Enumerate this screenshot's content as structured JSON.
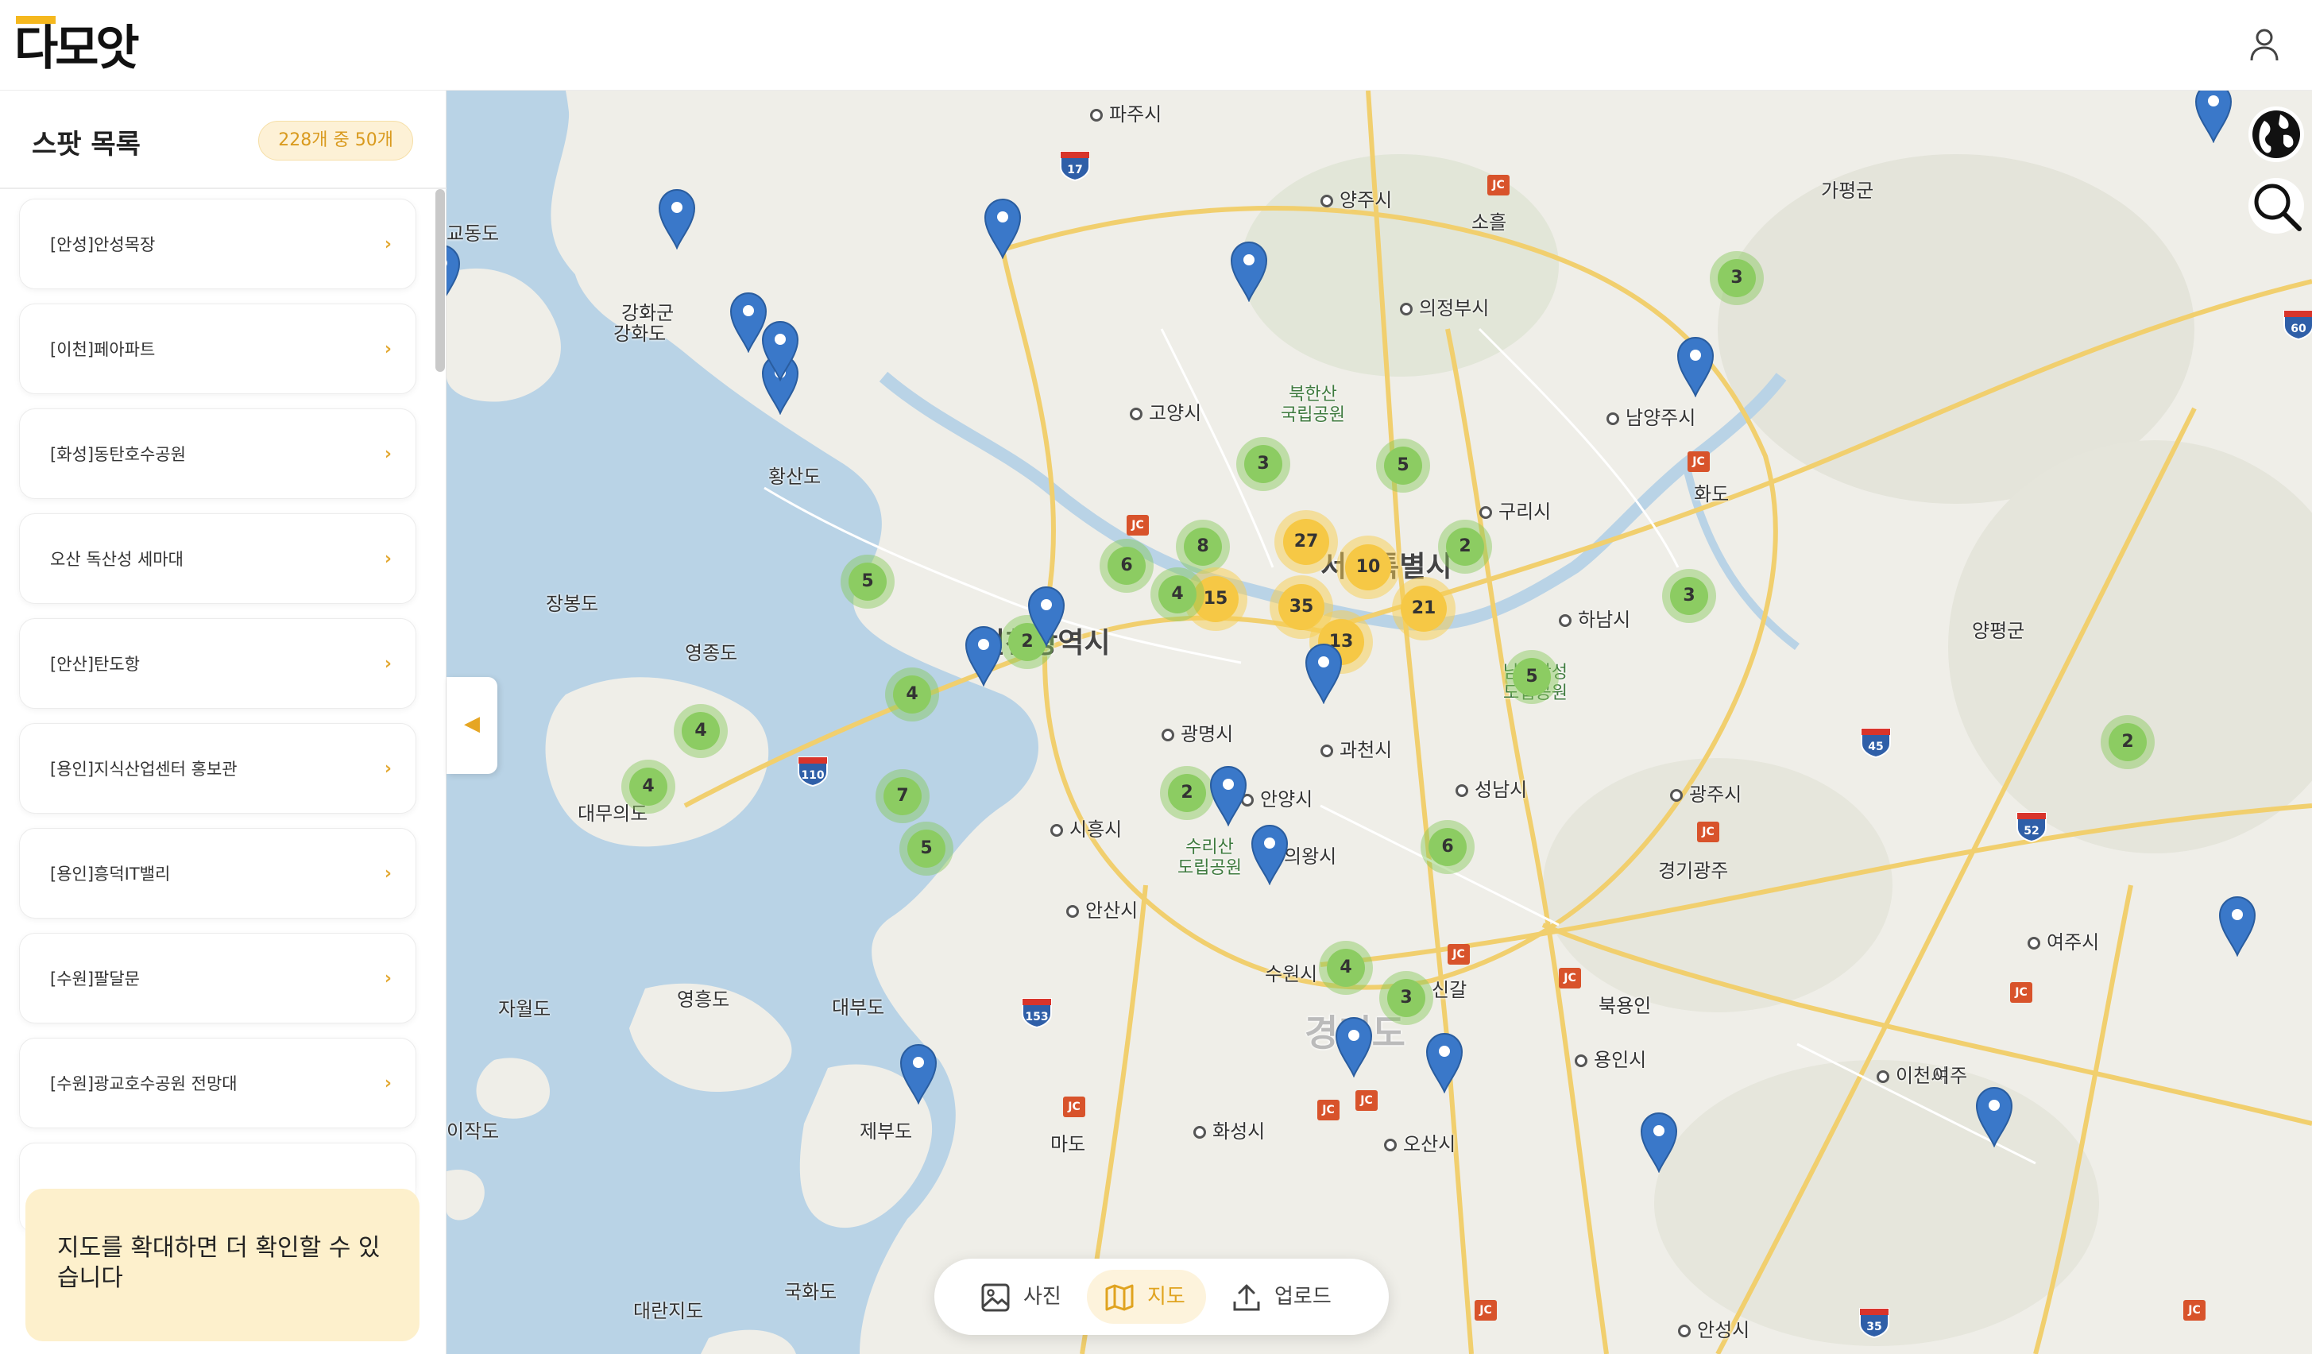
{
  "app": {
    "logo_text": "다모앗"
  },
  "sidebar": {
    "title": "스팟 목록",
    "count_badge": "228개 중 50개",
    "items": [
      {
        "label": "[안성]안성목장"
      },
      {
        "label": "[이천]페아파트"
      },
      {
        "label": "[화성]동탄호수공원"
      },
      {
        "label": "오산 독산성 세마대"
      },
      {
        "label": "[안산]탄도항"
      },
      {
        "label": "[용인]지식산업센터 홍보관"
      },
      {
        "label": "[용인]흥덕IT밸리"
      },
      {
        "label": "[수원]팔달문"
      },
      {
        "label": "[수원]광교호수공원 전망대"
      }
    ],
    "chevron": "›",
    "hint": "지도를 확대하면 더 확인할 수 있습니다"
  },
  "map": {
    "places": [
      {
        "name": "파주시",
        "cls": "dot"
      },
      {
        "name": "양주시",
        "cls": "dot"
      },
      {
        "name": "소흘",
        "cls": ""
      },
      {
        "name": "의정부시",
        "cls": "dot"
      },
      {
        "name": "가평군",
        "cls": ""
      },
      {
        "name": "강화군",
        "cls": ""
      },
      {
        "name": "강화도",
        "cls": ""
      },
      {
        "name": "교동도",
        "cls": ""
      },
      {
        "name": "고양시",
        "cls": "dot"
      },
      {
        "name": "북한산\n국립공원",
        "cls": "park"
      },
      {
        "name": "남양주시",
        "cls": "dot"
      },
      {
        "name": "화도",
        "cls": ""
      },
      {
        "name": "황산도",
        "cls": ""
      },
      {
        "name": "구리시",
        "cls": "dot"
      },
      {
        "name": "장봉도",
        "cls": ""
      },
      {
        "name": "서울특별시",
        "cls": "big"
      },
      {
        "name": "하남시",
        "cls": "dot"
      },
      {
        "name": "양평군",
        "cls": ""
      },
      {
        "name": "인천광역시",
        "cls": "big"
      },
      {
        "name": "영종도",
        "cls": ""
      },
      {
        "name": "광명시",
        "cls": "dot"
      },
      {
        "name": "과천시",
        "cls": "dot"
      },
      {
        "name": "성남시",
        "cls": "dot"
      },
      {
        "name": "광주시",
        "cls": "dot"
      },
      {
        "name": "안양시",
        "cls": "dot"
      },
      {
        "name": "시흥시",
        "cls": "dot"
      },
      {
        "name": "대무의도",
        "cls": ""
      },
      {
        "name": "수리산\n도립공원",
        "cls": "park"
      },
      {
        "name": "의왕시",
        "cls": "dot"
      },
      {
        "name": "남한산성\n도립공원",
        "cls": "park"
      },
      {
        "name": "경기광주",
        "cls": ""
      },
      {
        "name": "안산시",
        "cls": "dot"
      },
      {
        "name": "여주시",
        "cls": "dot"
      },
      {
        "name": "자월도",
        "cls": ""
      },
      {
        "name": "영흥도",
        "cls": ""
      },
      {
        "name": "대부도",
        "cls": ""
      },
      {
        "name": "수원시",
        "cls": ""
      },
      {
        "name": "신갈",
        "cls": ""
      },
      {
        "name": "북용인",
        "cls": ""
      },
      {
        "name": "경기도",
        "cls": "region"
      },
      {
        "name": "용인시",
        "cls": "dot"
      },
      {
        "name": "이천시",
        "cls": "dot"
      },
      {
        "name": "여주",
        "cls": ""
      },
      {
        "name": "이작도",
        "cls": ""
      },
      {
        "name": "제부도",
        "cls": ""
      },
      {
        "name": "마도",
        "cls": ""
      },
      {
        "name": "화성시",
        "cls": "dot"
      },
      {
        "name": "오산시",
        "cls": "dot"
      },
      {
        "name": "국화도",
        "cls": ""
      },
      {
        "name": "대란지도",
        "cls": ""
      },
      {
        "name": "안성시",
        "cls": "dot"
      }
    ],
    "clusters": [
      {
        "count": "3",
        "tone": "g"
      },
      {
        "count": "3",
        "tone": "g"
      },
      {
        "count": "5",
        "tone": "g"
      },
      {
        "count": "2",
        "tone": "g"
      },
      {
        "count": "6",
        "tone": "g"
      },
      {
        "count": "8",
        "tone": "g"
      },
      {
        "count": "27",
        "tone": "y"
      },
      {
        "count": "10",
        "tone": "y"
      },
      {
        "count": "15",
        "tone": "y"
      },
      {
        "count": "35",
        "tone": "y"
      },
      {
        "count": "21",
        "tone": "y"
      },
      {
        "count": "13",
        "tone": "y"
      },
      {
        "count": "3",
        "tone": "g"
      },
      {
        "count": "5",
        "tone": "g"
      },
      {
        "count": "2",
        "tone": "g"
      },
      {
        "count": "4",
        "tone": "g"
      },
      {
        "count": "4",
        "tone": "g"
      },
      {
        "count": "4",
        "tone": "g"
      },
      {
        "count": "5",
        "tone": "g"
      },
      {
        "count": "2",
        "tone": "g"
      },
      {
        "count": "4",
        "tone": "g"
      },
      {
        "count": "7",
        "tone": "g"
      },
      {
        "count": "5",
        "tone": "g"
      },
      {
        "count": "2",
        "tone": "g"
      },
      {
        "count": "6",
        "tone": "g"
      },
      {
        "count": "4",
        "tone": "g"
      },
      {
        "count": "3",
        "tone": "g"
      }
    ],
    "road_shields": [
      "17",
      "60",
      "110",
      "45",
      "52",
      "153",
      "35",
      "JC"
    ]
  },
  "tabs": [
    {
      "label": "사진",
      "icon": "image-icon"
    },
    {
      "label": "지도",
      "icon": "map-icon",
      "active": true
    },
    {
      "label": "업로드",
      "icon": "upload-icon"
    }
  ],
  "colors": {
    "accent": "#f5b81e",
    "cluster_green": "#8ccc62",
    "cluster_yellow": "#f6c845",
    "pin_blue": "#3a78c9",
    "water": "#b9d3e6"
  }
}
